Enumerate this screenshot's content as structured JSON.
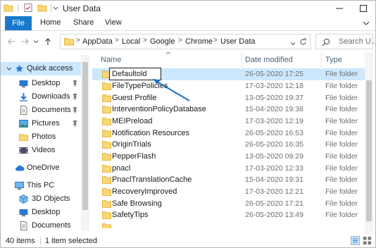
{
  "window": {
    "title": "User Data"
  },
  "ribbon": {
    "file": "File",
    "home": "Home",
    "share": "Share",
    "view": "View"
  },
  "address": {
    "crumbs": [
      "AppData",
      "Local",
      "Google",
      "Chrome",
      "User Data"
    ],
    "separator": ">",
    "search_placeholder": "Search U..."
  },
  "nav": {
    "items": [
      {
        "label": "Quick access",
        "icon": "star-icon",
        "pinned": false
      },
      {
        "label": "Desktop",
        "icon": "desktop-icon",
        "pinned": true
      },
      {
        "label": "Downloads",
        "icon": "download-icon",
        "pinned": true
      },
      {
        "label": "Documents",
        "icon": "documents-icon",
        "pinned": true
      },
      {
        "label": "Pictures",
        "icon": "pictures-icon",
        "pinned": true
      },
      {
        "label": "Photos",
        "icon": "folder-icon",
        "pinned": false
      },
      {
        "label": "Videos",
        "icon": "videos-icon",
        "pinned": false
      },
      {
        "label": "OneDrive",
        "icon": "cloud-icon",
        "pinned": false
      },
      {
        "label": "This PC",
        "icon": "pc-icon",
        "pinned": false
      },
      {
        "label": "3D Objects",
        "icon": "cube-icon",
        "pinned": false
      },
      {
        "label": "Desktop",
        "icon": "desktop-icon",
        "pinned": false
      },
      {
        "label": "Documents",
        "icon": "documents-icon",
        "pinned": false
      }
    ]
  },
  "columns": {
    "name": "Name",
    "date": "Date modified",
    "type": "Type"
  },
  "files": [
    {
      "name": "Defaultold",
      "date": "26-05-2020 17:25",
      "type": "File folder",
      "selected": true,
      "renaming": true
    },
    {
      "name": "FileTypePolicies",
      "date": "17-03-2020 12:18",
      "type": "File folder"
    },
    {
      "name": "Guest Profile",
      "date": "13-05-2020 19:37",
      "type": "File folder"
    },
    {
      "name": "InterventionPolicyDatabase",
      "date": "15-04-2020 19:38",
      "type": "File folder"
    },
    {
      "name": "MEIPreload",
      "date": "17-03-2020 12:19",
      "type": "File folder"
    },
    {
      "name": "Notification Resources",
      "date": "26-05-2020 16:53",
      "type": "File folder"
    },
    {
      "name": "OriginTrials",
      "date": "26-05-2020 16:35",
      "type": "File folder"
    },
    {
      "name": "PepperFlash",
      "date": "13-05-2020 09:29",
      "type": "File folder"
    },
    {
      "name": "pnacl",
      "date": "17-03-2020 12:33",
      "type": "File folder"
    },
    {
      "name": "PnaclTranslationCache",
      "date": "15-04-2020 19:31",
      "type": "File folder"
    },
    {
      "name": "RecoveryImproved",
      "date": "17-03-2020 12:21",
      "type": "File folder"
    },
    {
      "name": "Safe Browsing",
      "date": "26-05-2020 17:21",
      "type": "File folder"
    },
    {
      "name": "SafetyTips",
      "date": "26-05-2020 13:49",
      "type": "File folder"
    }
  ],
  "status": {
    "count": "40 items",
    "selected": "1 item selected"
  },
  "colors": {
    "accent": "#1979ca",
    "selection": "#cce8ff",
    "folder": "#f8d775",
    "arrow": "#1f6fc5"
  }
}
